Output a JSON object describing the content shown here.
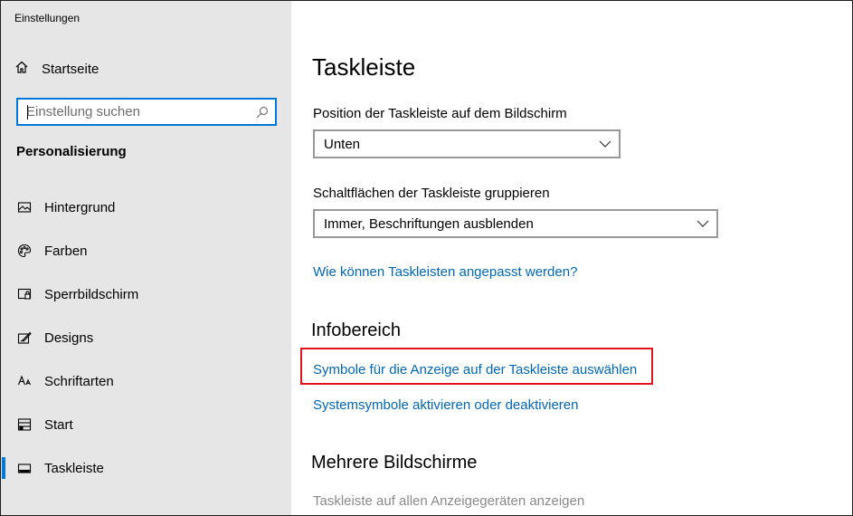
{
  "window": {
    "title": "Einstellungen"
  },
  "sidebar": {
    "home_label": "Startseite",
    "search": {
      "placeholder": "Einstellung suchen",
      "value": ""
    },
    "section_label": "Personalisierung",
    "items": [
      {
        "label": "Hintergrund",
        "icon": "picture-icon"
      },
      {
        "label": "Farben",
        "icon": "palette-icon"
      },
      {
        "label": "Sperrbildschirm",
        "icon": "lock-screen-icon"
      },
      {
        "label": "Designs",
        "icon": "brush-icon"
      },
      {
        "label": "Schriftarten",
        "icon": "font-icon"
      },
      {
        "label": "Start",
        "icon": "start-icon"
      },
      {
        "label": "Taskleiste",
        "icon": "taskbar-icon",
        "active": true
      }
    ]
  },
  "main": {
    "title": "Taskleiste",
    "position": {
      "label": "Position der Taskleiste auf dem Bildschirm",
      "value": "Unten"
    },
    "grouping": {
      "label": "Schaltflächen der Taskleiste gruppieren",
      "value": "Immer, Beschriftungen ausblenden"
    },
    "help_link": "Wie können Taskleisten angepasst werden?",
    "infobereich": {
      "heading": "Infobereich",
      "link_symbols": "Symbole für die Anzeige auf der Taskleiste auswählen",
      "link_system": "Systemsymbole aktivieren oder deaktivieren"
    },
    "multi_display": {
      "heading": "Mehrere Bildschirme",
      "toggle_label": "Taskleiste auf allen Anzeigegeräten anzeigen"
    }
  },
  "colors": {
    "accent": "#0078d7",
    "link": "#0067b8",
    "highlight": "#e3121c",
    "sidebar_bg": "#e6e6e6"
  }
}
